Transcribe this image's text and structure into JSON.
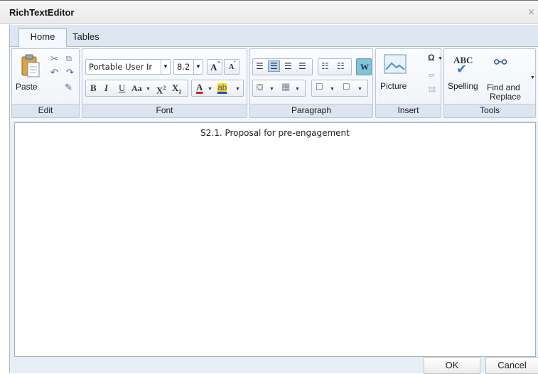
{
  "window": {
    "title": "RichTextEditor"
  },
  "tabs": [
    "Home",
    "Tables"
  ],
  "groups": {
    "edit": "Edit",
    "font": "Font",
    "paragraph": "Paragraph",
    "insert": "Insert",
    "tools": "Tools"
  },
  "edit": {
    "paste": "Paste"
  },
  "font": {
    "family": "Portable User Ir",
    "size": "8.2",
    "grow": "A",
    "shrink": "A",
    "bold": "B",
    "italic": "I",
    "underline": "U",
    "case": "Aa",
    "superscript": "X",
    "subscript": "X",
    "color_letter": "A",
    "highlight": "ab"
  },
  "paragraph": {
    "wrap": "W"
  },
  "insert": {
    "picture": "Picture",
    "symbol": "Ω"
  },
  "tools": {
    "spelling": "Spelling",
    "spelling_icon": "ABC",
    "find_replace_1": "Find and",
    "find_replace_2": "Replace"
  },
  "document": {
    "text": "S2.1. Proposal for pre-engagement"
  },
  "footer": {
    "ok": "OK",
    "cancel": "Cancel"
  },
  "colors": {
    "accent": "#dde6f1",
    "font_color": "#d71e1e",
    "highlight": "#f2e500",
    "wrap": "#82c3d8"
  }
}
